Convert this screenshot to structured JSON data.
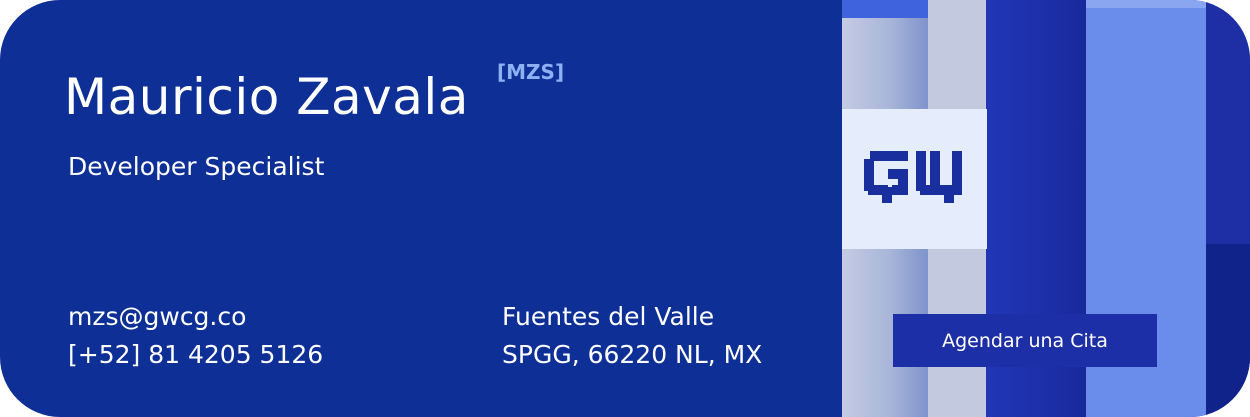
{
  "card": {
    "name": "Mauricio Zavala",
    "initials_tag": "[MZS]",
    "role": "Developer Specialist",
    "email": "mzs@gwcg.co",
    "phone": "[+52] 81 4205 5126",
    "address_line1": "Fuentes del Valle",
    "address_line2": "SPGG, 66220 NL, MX",
    "cta_label": "Agendar una Cita",
    "logo_text": "GW"
  },
  "colors": {
    "card_background": "#0d2f96",
    "initials_tag": "#8fb1f2",
    "cta_background": "#1d2fa6",
    "logo_background": "#e5ecfb",
    "logo_mark": "#1a2f9e"
  }
}
